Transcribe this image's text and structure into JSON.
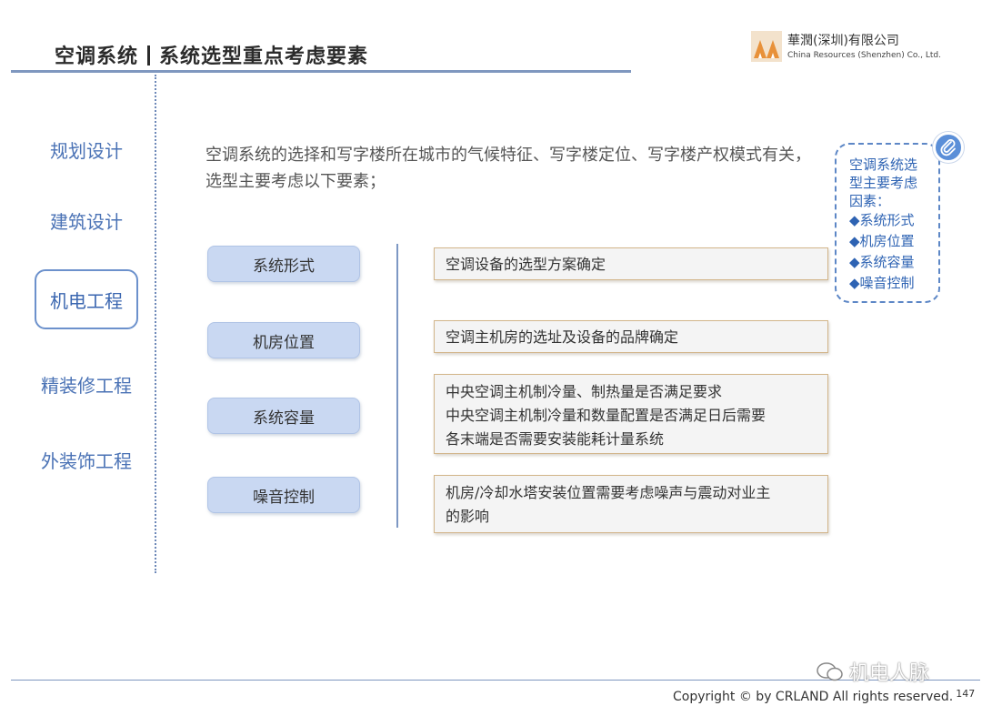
{
  "header": {
    "section": "空调系统",
    "title": "系统选型重点考虑要素"
  },
  "logo": {
    "name_cn": "華潤(深圳)有限公司",
    "name_en": "China Resources (Shenzhen) Co., Ltd."
  },
  "sidebar": {
    "items": [
      {
        "label": "规划设计",
        "active": false
      },
      {
        "label": "建筑设计",
        "active": false
      },
      {
        "label": "机电工程",
        "active": true
      },
      {
        "label": "精装修工程",
        "active": false
      },
      {
        "label": "外装饰工程",
        "active": false
      }
    ]
  },
  "intro": {
    "text": "空调系统的选择和写字楼所在城市的气候特征、写字楼定位、写字楼产权模式有关，选型主要考虑以下要素；"
  },
  "factors": [
    {
      "label": "系统形式",
      "desc": [
        "空调设备的选型方案确定"
      ]
    },
    {
      "label": "机房位置",
      "desc": [
        "空调主机房的选址及设备的品牌确定"
      ]
    },
    {
      "label": "系统容量",
      "desc": [
        "中央空调主机制冷量、制热量是否满足要求",
        "中央空调主机制冷量和数量配置是否满足日后需要",
        "各末端是否需要安装能耗计量系统"
      ]
    },
    {
      "label": "噪音控制",
      "desc": [
        "机房/冷却水塔安装位置需要考虑噪声与震动对业主",
        "的影响"
      ]
    }
  ],
  "callout": {
    "heading": [
      "空调系统选",
      "型主要考虑",
      "因素："
    ],
    "items": [
      "◆系统形式",
      "◆机房位置",
      "◆系统容量",
      "◆噪音控制"
    ],
    "icon": "paperclip-icon"
  },
  "footer": {
    "watermark": "机电人脉",
    "copyright": "Copyright © by CRLAND All rights reserved.",
    "page": "147"
  },
  "colors": {
    "accent": "#4a72b5",
    "pill_bg": "#c9d8f2",
    "desc_border": "#d2b58a",
    "logo": "#e8913a"
  }
}
